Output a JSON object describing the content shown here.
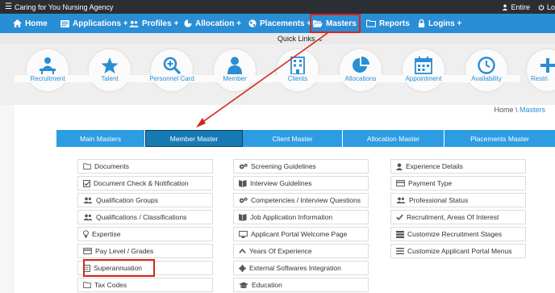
{
  "topbar": {
    "app_title": "Caring for You Nursing Agency",
    "user_label": "Entire",
    "logout_label": "Lo"
  },
  "nav": {
    "items": [
      {
        "label": "Home",
        "icon": "home-icon"
      },
      {
        "label": "Applications +",
        "icon": "cards-icon"
      },
      {
        "label": "Profiles +",
        "icon": "users-icon"
      },
      {
        "label": "Allocation +",
        "icon": "pie-icon"
      },
      {
        "label": "Placements +",
        "icon": "globe-icon"
      },
      {
        "label": "Masters",
        "icon": "folder-open-icon"
      },
      {
        "label": "Reports",
        "icon": "folder-icon"
      },
      {
        "label": "Logins +",
        "icon": "lock-icon"
      }
    ]
  },
  "quick_links": {
    "label": "Quick Links",
    "items": [
      {
        "label": "Recruitment",
        "icon": "recruitment-icon"
      },
      {
        "label": "Talent",
        "icon": "star-icon"
      },
      {
        "label": "Personnel Card",
        "icon": "zoom-icon"
      },
      {
        "label": "Member",
        "icon": "person-icon"
      },
      {
        "label": "Clients",
        "icon": "building-icon"
      },
      {
        "label": "Allocations",
        "icon": "pie-icon"
      },
      {
        "label": "Appointment",
        "icon": "calendar-icon"
      },
      {
        "label": "Availability",
        "icon": "clock-icon"
      },
      {
        "label": "Restri",
        "icon": "plus-icon"
      }
    ]
  },
  "breadcrumb": {
    "home": "Home",
    "sep": " \\ ",
    "current": "Masters"
  },
  "tabs": [
    {
      "label": "Main Masters",
      "active": false
    },
    {
      "label": "Member Master",
      "active": true
    },
    {
      "label": "Client Master",
      "active": false
    },
    {
      "label": "Allocation Master",
      "active": false
    },
    {
      "label": "Placements Master",
      "active": false
    }
  ],
  "columns": [
    [
      {
        "label": "Documents",
        "icon": "folder-outline-icon"
      },
      {
        "label": "Document Check & Notification",
        "icon": "check-square-icon"
      },
      {
        "label": "Qualification Groups",
        "icon": "users-icon"
      },
      {
        "label": "Qualifications / Classifications",
        "icon": "users-icon"
      },
      {
        "label": "Expertise",
        "icon": "lightbulb-icon"
      },
      {
        "label": "Pay Level / Grades",
        "icon": "card-icon"
      },
      {
        "label": "Superannuation",
        "icon": "list-box-icon",
        "highlighted": true
      },
      {
        "label": "Tax Codes",
        "icon": "folder-outline-icon"
      }
    ],
    [
      {
        "label": "Screening Guidelines",
        "icon": "gears-icon"
      },
      {
        "label": "Interview Guidelines",
        "icon": "book-icon"
      },
      {
        "label": "Competencies / Interview Questions",
        "icon": "gears-icon"
      },
      {
        "label": "Job Application Information",
        "icon": "book-icon"
      },
      {
        "label": "Applicant Portal Welcome Page",
        "icon": "monitor-icon"
      },
      {
        "label": "Years Of Experience",
        "icon": "chevron-icon"
      },
      {
        "label": "External Softwares Integration",
        "icon": "gear-icon"
      },
      {
        "label": "Education",
        "icon": "graduation-icon"
      }
    ],
    [
      {
        "label": "Experience Details",
        "icon": "user-icon"
      },
      {
        "label": "Payment Type",
        "icon": "card-icon"
      },
      {
        "label": "Professional Status",
        "icon": "users-icon"
      },
      {
        "label": "Recruitment, Areas Of Interest",
        "icon": "check-icon"
      },
      {
        "label": "Customize Recruitment Stages",
        "icon": "stack-icon"
      },
      {
        "label": "Customize Applicant Portal Menus",
        "icon": "menu-icon"
      }
    ]
  ],
  "colors": {
    "topbar": "#2b2f34",
    "nav": "#2a8ed6",
    "tab": "#2e9ce2",
    "tab_active": "#167ab4",
    "annotation": "#d6261e"
  }
}
